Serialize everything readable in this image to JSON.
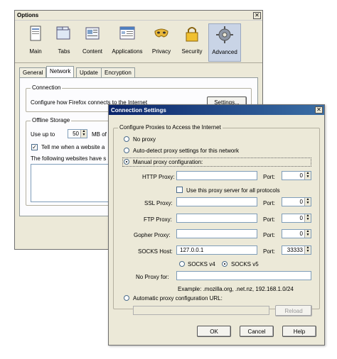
{
  "options": {
    "title": "Options",
    "toolbar": [
      {
        "label": "Main",
        "icon": "main-window-icon"
      },
      {
        "label": "Tabs",
        "icon": "tabs-icon"
      },
      {
        "label": "Content",
        "icon": "content-icon"
      },
      {
        "label": "Applications",
        "icon": "applications-icon"
      },
      {
        "label": "Privacy",
        "icon": "privacy-mask-icon"
      },
      {
        "label": "Security",
        "icon": "padlock-icon"
      },
      {
        "label": "Advanced",
        "icon": "gear-icon"
      }
    ],
    "tabs": [
      "General",
      "Network",
      "Update",
      "Encryption"
    ],
    "connection": {
      "legend": "Connection",
      "text": "Configure how Firefox connects to the Internet",
      "settings_button": "Settings..."
    },
    "offline": {
      "legend": "Offline Storage",
      "use_up_to": "Use up to",
      "size": "50",
      "mb_text": "MB of",
      "tell_me": "Tell me when a website a",
      "following": "The following websites have s"
    }
  },
  "conn": {
    "title": "Connection Settings",
    "configure_legend": "Configure Proxies to Access the Internet",
    "no_proxy": "No proxy",
    "auto_detect": "Auto-detect proxy settings for this network",
    "manual": "Manual proxy configuration:",
    "http_label": "HTTP Proxy:",
    "http_value": "",
    "http_port": "0",
    "use_same": "Use this proxy server for all protocols",
    "ssl_label": "SSL Proxy:",
    "ssl_value": "",
    "ssl_port": "0",
    "ftp_label": "FTP Proxy:",
    "ftp_value": "",
    "ftp_port": "0",
    "gopher_label": "Gopher Proxy:",
    "gopher_value": "",
    "gopher_port": "0",
    "socks_label": "SOCKS Host:",
    "socks_value": "127.0.0.1",
    "socks_port": "33333",
    "port_label": "Port:",
    "socks_v4": "SOCKS v4",
    "socks_v5": "SOCKS v5",
    "no_proxy_for": "No Proxy for:",
    "no_proxy_value": "",
    "example": "Example: .mozilla.org, .net.nz, 192.168.1.0/24",
    "auto_url": "Automatic proxy configuration URL:",
    "reload": "Reload",
    "ok": "OK",
    "cancel": "Cancel",
    "help": "Help"
  }
}
